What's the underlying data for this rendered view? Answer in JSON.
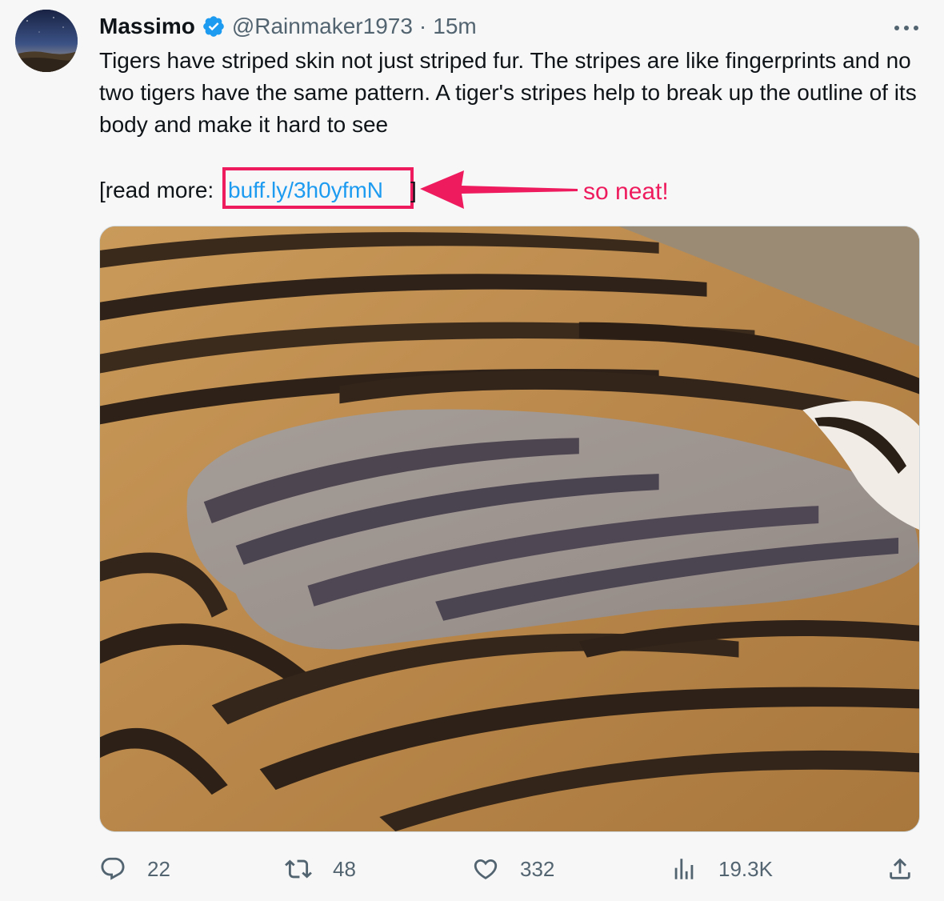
{
  "author": {
    "display_name": "Massimo",
    "handle": "@Rainmaker1973",
    "separator": "·",
    "timestamp": "15m",
    "verified": true
  },
  "tweet": {
    "text": "Tigers have striped skin not just striped fur. The stripes are like fingerprints and no two tigers have the same pattern. A tiger's stripes help to break up the outline of its body and make it hard to see",
    "read_more_prefix": "[read more: ",
    "link_text": "buff.ly/3h0yfmN",
    "read_more_suffix": "]"
  },
  "annotation": {
    "text": "so neat!",
    "color": "#ee1c5e"
  },
  "actions": {
    "replies": "22",
    "retweets": "48",
    "likes": "332",
    "views": "19.3K"
  },
  "icons": {
    "more": "more-horizontal-icon",
    "verified": "verified-badge-icon",
    "reply": "reply-icon",
    "retweet": "retweet-icon",
    "like": "heart-icon",
    "views": "views-chart-icon",
    "share": "share-icon"
  },
  "colors": {
    "link": "#1d9bf0",
    "secondary_text": "#536471",
    "verified": "#1d9bf0",
    "highlight": "#ee1c5e"
  }
}
